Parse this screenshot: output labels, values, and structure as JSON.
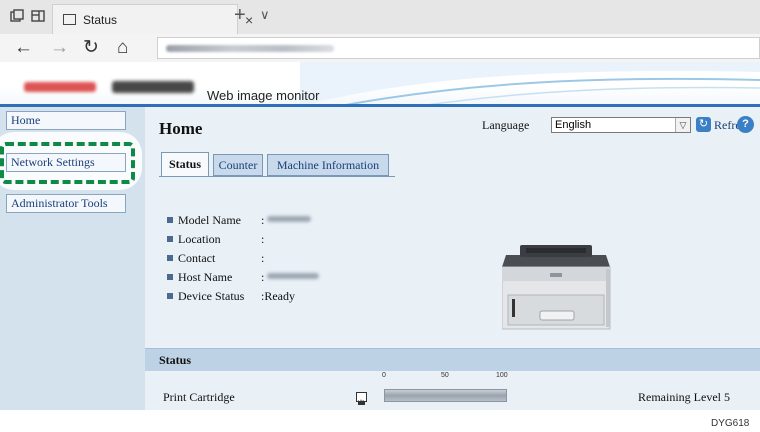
{
  "browser": {
    "tab_title": "Status",
    "tab_close": "×",
    "new_tab": "+",
    "tab_list": "∨",
    "nav_back": "←",
    "nav_forward": "→",
    "nav_refresh": "↻",
    "nav_home": "⌂"
  },
  "header": {
    "app_title": "Web image monitor"
  },
  "sidebar": {
    "items": [
      {
        "label": "Home"
      },
      {
        "label": "Network Settings"
      },
      {
        "label": "Administrator Tools"
      }
    ]
  },
  "main": {
    "title": "Home",
    "language_label": "Language",
    "language_value": "English",
    "refresh_label": "Refresh",
    "help_glyph": "?",
    "refresh_glyph": "↻",
    "tabs": [
      {
        "label": "Status",
        "active": true
      },
      {
        "label": "Counter",
        "active": false
      },
      {
        "label": "Machine Information",
        "active": false
      }
    ],
    "info": [
      {
        "label": "Model Name",
        "sep": ":",
        "value": ""
      },
      {
        "label": "Location",
        "sep": ":",
        "value": ""
      },
      {
        "label": "Contact",
        "sep": ":",
        "value": ""
      },
      {
        "label": "Host Name",
        "sep": ":",
        "value": ""
      },
      {
        "label": "Device Status",
        "sep": ":",
        "value": "Ready"
      }
    ],
    "status_section": {
      "title": "Status",
      "scale": [
        "0",
        "50",
        "100"
      ],
      "cartridge_label": "Print Cartridge",
      "remaining_label": "Remaining Level 5",
      "remaining_fraction": 1.0
    }
  },
  "footer": {
    "code": "DYG618"
  },
  "colors": {
    "accent_blue": "#2e6fb5",
    "highlight_green": "#0e8a47",
    "sidebar_bg": "#d4e2ee",
    "main_bg": "#e9f0f6"
  }
}
